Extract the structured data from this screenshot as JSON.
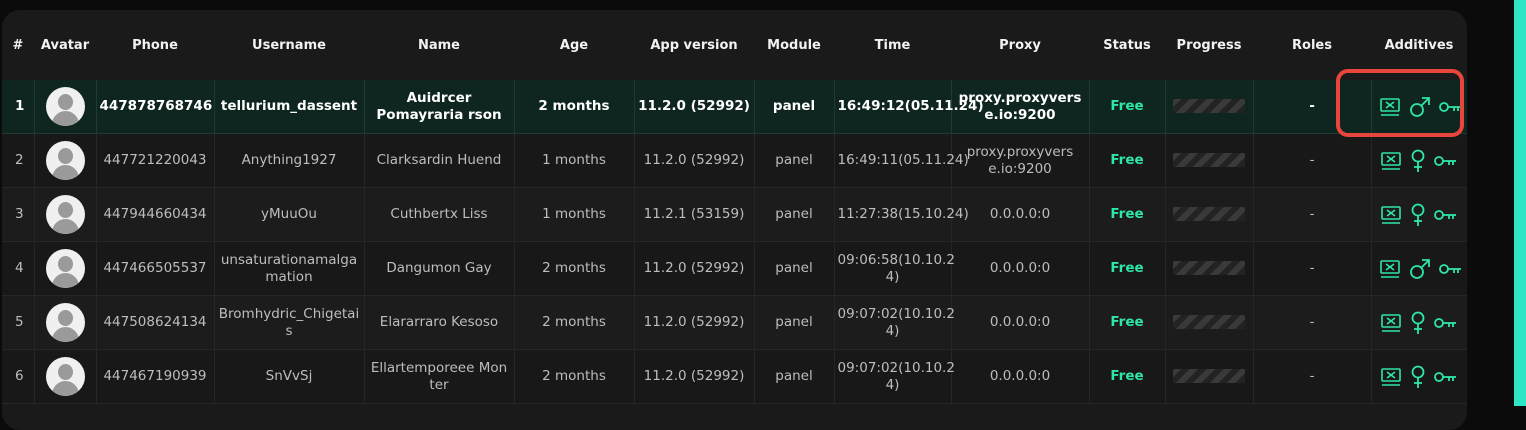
{
  "colors": {
    "accent": "#2ee6a6",
    "highlight": "#e8453c",
    "selected_row": "#0f2520"
  },
  "headers": [
    "#",
    "Avatar",
    "Phone",
    "Username",
    "Name",
    "Age",
    "App version",
    "Module",
    "Time",
    "Proxy",
    "Status",
    "Progress",
    "Roles",
    "Additives"
  ],
  "rows": [
    {
      "num": "1",
      "phone": "447878768746",
      "username": "tellurium_dassent",
      "name": "Auidrcer Pomayraria rson",
      "age": "2 months",
      "app_version": "11.2.0 (52992)",
      "module": "panel",
      "time": "16:49:12(05.11.24)",
      "proxy": "proxy.proxyvers e.io:9200",
      "status": "Free",
      "roles": "-",
      "gender": "male",
      "gender_icon": "male-icon"
    },
    {
      "num": "2",
      "phone": "447721220043",
      "username": "Anything1927",
      "name": "Clarksardin Huend",
      "age": "1 months",
      "app_version": "11.2.0 (52992)",
      "module": "panel",
      "time": "16:49:11(05.11.24)",
      "proxy": "proxy.proxyvers e.io:9200",
      "status": "Free",
      "roles": "-",
      "gender": "female",
      "gender_icon": "female-icon"
    },
    {
      "num": "3",
      "phone": "447944660434",
      "username": "yMuuOu",
      "name": "Cuthbertx Liss",
      "age": "1 months",
      "app_version": "11.2.1 (53159)",
      "module": "panel",
      "time": "11:27:38(15.10.24)",
      "proxy": "0.0.0.0:0",
      "status": "Free",
      "roles": "-",
      "gender": "female",
      "gender_icon": "female-icon"
    },
    {
      "num": "4",
      "phone": "447466505537",
      "username": "unsaturationamalga mation",
      "name": "Dangumon Gay",
      "age": "2 months",
      "app_version": "11.2.0 (52992)",
      "module": "panel",
      "time": "09:06:58(10.10.2 4)",
      "proxy": "0.0.0.0:0",
      "status": "Free",
      "roles": "-",
      "gender": "male",
      "gender_icon": "male-icon"
    },
    {
      "num": "5",
      "phone": "447508624134",
      "username": "Bromhydric_Chigetai s",
      "name": "Elararraro Kesoso",
      "age": "2 months",
      "app_version": "11.2.0 (52992)",
      "module": "panel",
      "time": "09:07:02(10.10.2 4)",
      "proxy": "0.0.0.0:0",
      "status": "Free",
      "roles": "-",
      "gender": "female",
      "gender_icon": "female-icon"
    },
    {
      "num": "6",
      "phone": "447467190939",
      "username": "SnVvSj",
      "name": "Ellartemporeee Mon ter",
      "age": "2 months",
      "app_version": "11.2.0 (52992)",
      "module": "panel",
      "time": "09:07:02(10.10.2 4)",
      "proxy": "0.0.0.0:0",
      "status": "Free",
      "roles": "-",
      "gender": "female",
      "gender_icon": "female-icon"
    }
  ]
}
